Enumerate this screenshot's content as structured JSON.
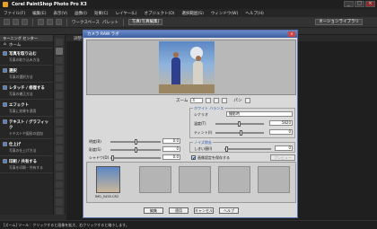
{
  "window": {
    "title": "Corel PaintShop Photo Pro X3",
    "minimize": "_",
    "maximize": "□",
    "close": "×"
  },
  "menu": [
    "ファイル(F)",
    "編集(E)",
    "表示(V)",
    "画像(I)",
    "効果(C)",
    "レイヤー(L)",
    "オブジェクト(O)",
    "選択範囲(S)",
    "ウィンドウ(W)",
    "ヘルプ(H)"
  ],
  "toolbar": {
    "workspace_label": "ワークスペース",
    "panel_label": "パレット",
    "view_label": "写真(写真編集)",
    "right_label": "ネーションライブラリ"
  },
  "left_panel": {
    "header": "ラーニング センター",
    "home": "ホーム",
    "items": [
      {
        "title": "写真を取り込む",
        "desc": "写真の取り込み方法"
      },
      {
        "title": "選択",
        "desc": "写真の選択方法"
      },
      {
        "title": "レタッチ / 修復する",
        "desc": "写真の補正方法"
      },
      {
        "title": "エフェクト",
        "desc": "写真に効果を適用"
      },
      {
        "title": "テキスト / グラフィック",
        "desc": "テキストや図形の追加"
      },
      {
        "title": "仕上げ",
        "desc": "写真の仕上げ方法"
      },
      {
        "title": "印刷 / 共有する",
        "desc": "写真を印刷・共有する"
      }
    ]
  },
  "doc_tabs": [
    "調整ウィンドウ",
    "開く済み"
  ],
  "dialog": {
    "title": "カメラ RAW ラボ",
    "close": "×",
    "zoom_label": "ズーム",
    "zoom_value": "4",
    "pan_label": "パン",
    "white_balance": {
      "legend": "ホワイト バランス",
      "scene_label": "シナリオ",
      "scene_value": "撮影時",
      "temp_label": "温度(T)",
      "temp_value": "5820",
      "tint_label": "ティント(I)",
      "tint_value": "0"
    },
    "noise": {
      "legend": "ノイズ除去",
      "label": "しきい値(I)",
      "value": "0"
    },
    "sliders": [
      {
        "label": "明度(B)",
        "value": "0.0"
      },
      {
        "label": "彩度(S)",
        "value": "0"
      },
      {
        "label": "シャドウ(D)",
        "value": "0.0"
      }
    ],
    "checkbox_label": "画像設定を保存する",
    "preview_button": "プレビュー",
    "filmstrip": {
      "selected_label": "IMG_5455.CR2"
    },
    "buttons": [
      "編集",
      "適用",
      "キャンセル",
      "ヘルプ"
    ]
  },
  "status_bar": "[ズーム] ツール：クリックすると画像を拡大、右クリックすると縮小します。"
}
